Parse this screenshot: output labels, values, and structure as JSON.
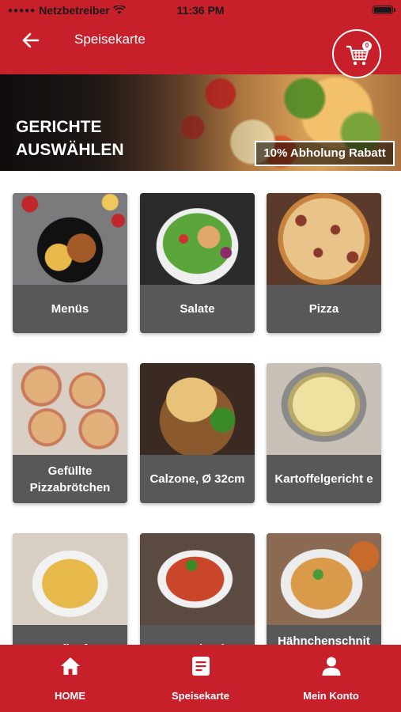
{
  "status_bar": {
    "carrier": "Netzbetreiber",
    "time": "11:36 PM"
  },
  "header": {
    "title": "Speisekarte",
    "cart_count": "0"
  },
  "hero": {
    "title_line1": "GERICHTE",
    "title_line2": "AUSWÄHLEN",
    "badge": "10% Abholung Rabatt"
  },
  "categories": [
    {
      "label": "Menüs",
      "icon": "grilled-chicken-fries"
    },
    {
      "label": "Salate",
      "icon": "chicken-salad"
    },
    {
      "label": "Pizza",
      "icon": "salami-pizza"
    },
    {
      "label": "Gefüllte Pizzabrötchen",
      "icon": "pizza-rolls"
    },
    {
      "label": "Calzone, Ø 32cm",
      "icon": "calzone"
    },
    {
      "label": "Kartoffelgericht e",
      "icon": "potato-gratin"
    },
    {
      "label": "Aufläufe",
      "icon": "casserole"
    },
    {
      "label": "Spaghetti",
      "icon": "spaghetti"
    },
    {
      "label": "Hähnchenschnit zel",
      "icon": "chicken-schnitzel"
    }
  ],
  "tabbar": {
    "items": [
      {
        "label": "HOME",
        "icon": "home-icon"
      },
      {
        "label": "Speisekarte",
        "icon": "menu-list-icon"
      },
      {
        "label": "Mein Konto",
        "icon": "person-icon"
      }
    ]
  },
  "colors": {
    "brand_red": "#c8202b",
    "card_label_bg": "#585858"
  }
}
